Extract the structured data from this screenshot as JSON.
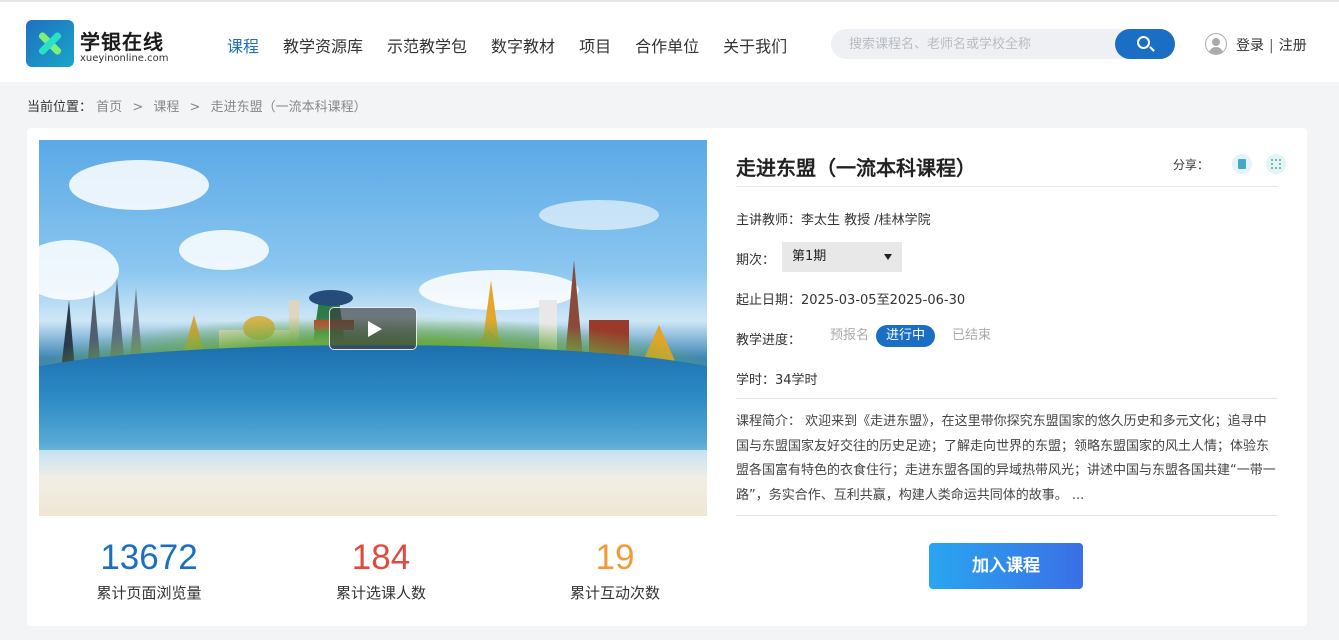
{
  "header": {
    "logo_name": "学银在线",
    "logo_domain": "xueyinonline.com",
    "nav": [
      {
        "label": "课程",
        "active": true
      },
      {
        "label": "教学资源库",
        "active": false
      },
      {
        "label": "示范教学包",
        "active": false
      },
      {
        "label": "数字教材",
        "active": false
      },
      {
        "label": "项目",
        "active": false
      },
      {
        "label": "合作单位",
        "active": false
      },
      {
        "label": "关于我们",
        "active": false
      }
    ],
    "search_placeholder": "搜索课程名、老师名或学校全称",
    "login": "登录",
    "separator": "|",
    "register": "注册"
  },
  "breadcrumb": {
    "label": "当前位置：",
    "items": [
      "首页",
      "课程",
      "走进东盟（一流本科课程）"
    ],
    "separator": ">"
  },
  "course": {
    "title": "走进东盟（一流本科课程）",
    "share_label": "分享：",
    "teacher": "主讲教师：李太生 教授 /桂林学院",
    "term_label": "期次：",
    "term_value": "第1期",
    "date_label": "起止日期：",
    "date_value": "2025-03-05至2025-06-30",
    "progress_label": "教学进度：",
    "progress_tags": [
      "预报名",
      "进行中",
      "已结束"
    ],
    "progress_active": "进行中",
    "hours": "学时：34学时",
    "intro": "课程简介：  欢迎来到《走进东盟》，在这里带你探究东盟国家的悠久历史和多元文化；追寻中国与东盟国家友好交往的历史足迹；了解走向世界的东盟；领略东盟国家的风土人情；体验东盟各国富有特色的衣食住行；走进东盟各国的异域热带风光；讲述中国与东盟各国共建“一带一路”，务实合作、互利共赢，构建人类命运共同体的故事。 ...",
    "join_label": "加入课程"
  },
  "stats": [
    {
      "value": "13672",
      "label": "累计页面浏览量",
      "color": "#1a6fc4"
    },
    {
      "value": "184",
      "label": "累计选课人数",
      "color": "#e04a3f"
    },
    {
      "value": "19",
      "label": "累计互动次数",
      "color": "#f29a38"
    }
  ],
  "colors": {
    "accent": "#1a6fc4",
    "join_gradient_start": "#29a6f0",
    "join_gradient_end": "#3b6fe6"
  }
}
